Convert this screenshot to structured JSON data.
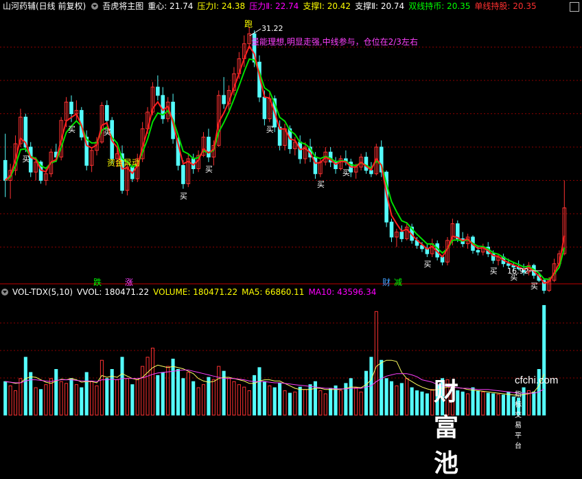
{
  "header": {
    "stock_name": "山河药辅(日线 前复权)",
    "indicator": "吾虎将主图",
    "items": [
      {
        "label": "重心: 21.74",
        "color": "#ffffff"
      },
      {
        "label": "压力Ⅰ: 24.38",
        "color": "#ffff00"
      },
      {
        "label": "压力Ⅱ: 22.74",
        "color": "#ff00ff"
      },
      {
        "label": "支撑Ⅰ: 20.42",
        "color": "#ffff00"
      },
      {
        "label": "支撑Ⅱ: 20.74",
        "color": "#ffffff"
      },
      {
        "label": "双线持币: 20.35",
        "color": "#00ff00"
      },
      {
        "label": "单线持股: 20.35",
        "color": "#ff3030"
      }
    ]
  },
  "volume_header": {
    "name": "VOL-TDX(5,10)",
    "items": [
      {
        "label": "VVOL: 180471.22",
        "color": "#ffffff"
      },
      {
        "label": "VOLUME: 180471.22",
        "color": "#ffff00"
      },
      {
        "label": "MA5: 66860.11",
        "color": "#ffff00"
      },
      {
        "label": "MA10: 43596.34",
        "color": "#ff00ff"
      }
    ]
  },
  "annotations": {
    "high_label": "31.22",
    "low_label": "16.92",
    "run_label": "跑",
    "comment": "量能理想,明显走强,中线参与，仓位在2/3左右",
    "fund_label": "资金异动",
    "buy_label": "买",
    "signal_drop": "跌",
    "signal_rise": "涨",
    "signal_cai": "财",
    "signal_jian": "减"
  },
  "watermark": {
    "cn": "财富池",
    "en": "cfchi.com",
    "sub": "指标交易平台"
  },
  "colors": {
    "up": "#ff3232",
    "down": "#54fcfc",
    "fast_line": "#ff2020",
    "slow_line": "#00e000",
    "ma5": "#ffff60",
    "ma10": "#ff40ff",
    "grid": "#8b0000"
  },
  "chart_data": [
    {
      "type": "candlestick",
      "title": "山河药辅(日线 前复权)",
      "y_range": [
        16,
        32
      ],
      "y_grid_values": [
        18,
        20,
        22,
        24,
        26,
        28,
        30
      ],
      "ohlc": [
        [
          23.2,
          24.8,
          21.0,
          22.0
        ],
        [
          22.0,
          23.0,
          20.9,
          22.6
        ],
        [
          22.6,
          24.7,
          22.3,
          24.2
        ],
        [
          24.2,
          26.3,
          24.0,
          25.8
        ],
        [
          25.8,
          26.0,
          23.7,
          24.0
        ],
        [
          24.0,
          24.3,
          22.2,
          22.5
        ],
        [
          22.5,
          23.4,
          22.0,
          23.1
        ],
        [
          23.1,
          23.2,
          21.8,
          22.0
        ],
        [
          22.0,
          22.8,
          21.7,
          22.4
        ],
        [
          22.4,
          23.9,
          22.2,
          23.7
        ],
        [
          23.7,
          24.2,
          23.1,
          23.4
        ],
        [
          23.4,
          25.8,
          23.2,
          25.6
        ],
        [
          25.6,
          27.0,
          25.2,
          26.7
        ],
        [
          26.7,
          27.1,
          25.5,
          26.0
        ],
        [
          26.0,
          26.8,
          25.6,
          26.2
        ],
        [
          26.2,
          26.4,
          24.4,
          24.6
        ],
        [
          24.6,
          25.0,
          22.6,
          22.9
        ],
        [
          22.9,
          24.0,
          22.5,
          23.8
        ],
        [
          23.8,
          24.6,
          23.5,
          24.3
        ],
        [
          24.3,
          26.7,
          24.2,
          26.5
        ],
        [
          26.5,
          26.8,
          25.3,
          25.6
        ],
        [
          25.6,
          25.8,
          23.0,
          23.3
        ],
        [
          23.3,
          24.0,
          22.8,
          23.6
        ],
        [
          23.6,
          24.1,
          21.2,
          21.4
        ],
        [
          21.4,
          23.1,
          21.1,
          22.8
        ],
        [
          22.8,
          22.9,
          21.9,
          22.1
        ],
        [
          22.1,
          23.6,
          21.9,
          23.3
        ],
        [
          23.3,
          25.5,
          23.1,
          25.1
        ],
        [
          25.1,
          26.4,
          24.8,
          26.1
        ],
        [
          26.1,
          27.9,
          25.9,
          27.6
        ],
        [
          27.6,
          28.3,
          26.8,
          27.1
        ],
        [
          27.1,
          27.6,
          25.4,
          25.7
        ],
        [
          25.7,
          27.0,
          25.5,
          26.7
        ],
        [
          26.7,
          27.2,
          24.2,
          24.5
        ],
        [
          24.5,
          24.8,
          22.6,
          22.9
        ],
        [
          22.9,
          23.2,
          21.5,
          21.8
        ],
        [
          21.8,
          23.6,
          21.6,
          23.3
        ],
        [
          23.3,
          23.6,
          22.4,
          22.7
        ],
        [
          22.7,
          23.8,
          22.5,
          23.5
        ],
        [
          23.5,
          24.9,
          23.4,
          24.6
        ],
        [
          24.6,
          25.1,
          23.1,
          23.4
        ],
        [
          23.4,
          24.4,
          22.9,
          24.1
        ],
        [
          24.1,
          27.4,
          24.0,
          27.1
        ],
        [
          27.1,
          28.2,
          26.3,
          26.6
        ],
        [
          26.6,
          27.7,
          26.2,
          27.4
        ],
        [
          27.4,
          28.8,
          27.1,
          28.4
        ],
        [
          28.4,
          29.7,
          28.1,
          29.3
        ],
        [
          29.3,
          30.7,
          28.8,
          30.2
        ],
        [
          30.2,
          31.22,
          29.9,
          30.8
        ],
        [
          30.8,
          31.0,
          28.8,
          29.1
        ],
        [
          29.1,
          29.5,
          26.7,
          27.0
        ],
        [
          27.0,
          27.4,
          25.3,
          25.7
        ],
        [
          25.7,
          27.3,
          25.5,
          26.9
        ],
        [
          26.9,
          27.1,
          24.9,
          25.2
        ],
        [
          25.2,
          25.6,
          23.8,
          24.1
        ],
        [
          24.1,
          25.4,
          23.8,
          25.1
        ],
        [
          25.1,
          25.3,
          23.6,
          23.9
        ],
        [
          23.9,
          24.6,
          23.5,
          24.3
        ],
        [
          24.3,
          24.7,
          23.0,
          23.3
        ],
        [
          23.3,
          24.3,
          23.0,
          24.0
        ],
        [
          24.0,
          24.5,
          23.1,
          23.4
        ],
        [
          23.4,
          23.7,
          22.1,
          22.4
        ],
        [
          22.4,
          23.3,
          22.2,
          23.1
        ],
        [
          23.1,
          24.0,
          22.9,
          23.7
        ],
        [
          23.7,
          24.0,
          22.8,
          23.1
        ],
        [
          23.1,
          23.4,
          22.4,
          22.7
        ],
        [
          22.7,
          23.5,
          22.6,
          23.3
        ],
        [
          23.3,
          23.8,
          22.9,
          23.1
        ],
        [
          23.1,
          23.3,
          22.2,
          22.5
        ],
        [
          22.5,
          23.0,
          22.1,
          22.8
        ],
        [
          22.8,
          23.6,
          22.6,
          23.4
        ],
        [
          23.4,
          23.7,
          22.4,
          22.6
        ],
        [
          22.6,
          23.1,
          22.2,
          22.4
        ],
        [
          22.4,
          24.2,
          22.3,
          24.0
        ],
        [
          24.0,
          24.4,
          22.2,
          22.5
        ],
        [
          22.5,
          22.6,
          19.2,
          19.5
        ],
        [
          19.5,
          19.7,
          18.3,
          18.6
        ],
        [
          18.6,
          19.1,
          18.0,
          18.9
        ],
        [
          18.9,
          19.3,
          18.3,
          18.5
        ],
        [
          18.5,
          19.5,
          18.4,
          19.2
        ],
        [
          19.2,
          19.4,
          18.2,
          18.4
        ],
        [
          18.4,
          18.6,
          17.9,
          18.1
        ],
        [
          18.1,
          18.3,
          17.7,
          17.9
        ],
        [
          17.9,
          18.2,
          17.4,
          17.6
        ],
        [
          17.6,
          18.5,
          17.4,
          18.2
        ],
        [
          18.2,
          18.4,
          17.2,
          17.4
        ],
        [
          17.4,
          17.5,
          16.9,
          17.1
        ],
        [
          17.1,
          18.6,
          16.9,
          18.4
        ],
        [
          18.4,
          19.7,
          18.1,
          19.4
        ],
        [
          19.4,
          19.6,
          18.3,
          18.5
        ],
        [
          18.5,
          18.9,
          18.0,
          18.2
        ],
        [
          18.2,
          18.8,
          17.9,
          18.6
        ],
        [
          18.6,
          18.7,
          17.6,
          17.8
        ],
        [
          17.8,
          18.1,
          17.5,
          17.7
        ],
        [
          17.7,
          18.2,
          17.5,
          18.0
        ],
        [
          18.0,
          18.3,
          17.4,
          17.6
        ],
        [
          17.6,
          17.8,
          17.0,
          17.2
        ],
        [
          17.2,
          17.6,
          16.9,
          17.4
        ],
        [
          17.4,
          17.6,
          16.8,
          17.0
        ],
        [
          17.0,
          17.3,
          16.7,
          16.9
        ],
        [
          16.9,
          17.1,
          16.6,
          16.8
        ],
        [
          16.8,
          17.2,
          16.6,
          16.7
        ],
        [
          16.7,
          17.0,
          16.3,
          16.5
        ],
        [
          16.5,
          17.1,
          16.3,
          16.9
        ],
        [
          16.9,
          17.0,
          16.1,
          16.3
        ],
        [
          16.3,
          16.4,
          15.9,
          16.0
        ],
        [
          16.0,
          16.1,
          15.2,
          15.4
        ],
        [
          15.4,
          16.2,
          15.3,
          16.0
        ],
        [
          16.0,
          17.3,
          15.9,
          17.0
        ],
        [
          17.0,
          17.8,
          16.8,
          17.6
        ],
        [
          17.6,
          22.0,
          17.5,
          20.35
        ]
      ],
      "volume": [
        55,
        48,
        40,
        60,
        95,
        70,
        45,
        42,
        50,
        60,
        75,
        55,
        52,
        60,
        50,
        45,
        70,
        55,
        48,
        90,
        60,
        75,
        58,
        95,
        60,
        50,
        58,
        80,
        95,
        110,
        65,
        70,
        80,
        92,
        75,
        60,
        70,
        55,
        45,
        50,
        62,
        58,
        80,
        72,
        60,
        55,
        50,
        46,
        40,
        65,
        78,
        55,
        48,
        45,
        52,
        40,
        36,
        38,
        46,
        42,
        50,
        55,
        40,
        35,
        44,
        48,
        40,
        52,
        60,
        45,
        38,
        72,
        95,
        170,
        90,
        60,
        55,
        48,
        52,
        60,
        45,
        40,
        38,
        35,
        42,
        50,
        60,
        58,
        45,
        40,
        38,
        35,
        45,
        40,
        38,
        36,
        35,
        34,
        33,
        38,
        30,
        28,
        45,
        40,
        38,
        75,
        180
      ],
      "ma5": [
        55,
        54,
        52,
        53,
        60,
        63,
        62,
        58,
        54,
        52,
        56,
        59,
        58,
        60,
        58,
        54,
        55,
        55,
        53,
        65,
        62,
        64,
        62,
        68,
        64,
        60,
        58,
        62,
        70,
        78,
        82,
        80,
        78,
        80,
        78,
        76,
        72,
        68,
        60,
        56,
        54,
        55,
        60,
        62,
        62,
        60,
        58,
        56,
        52,
        52,
        56,
        58,
        58,
        56,
        56,
        52,
        48,
        44,
        42,
        42,
        42,
        44,
        44,
        42,
        42,
        42,
        42,
        44,
        46,
        46,
        45,
        50,
        58,
        80,
        86,
        90,
        90,
        88,
        70,
        60,
        55,
        50,
        46,
        43,
        41,
        42,
        44,
        46,
        46,
        45,
        44,
        42,
        41,
        40,
        39,
        38,
        37,
        36,
        35,
        34,
        33,
        32,
        34,
        35,
        38,
        48,
        67
      ],
      "ma10": [
        55,
        54,
        53,
        53,
        56,
        58,
        58,
        57,
        56,
        55,
        57,
        58,
        58,
        58,
        57,
        56,
        56,
        56,
        55,
        58,
        58,
        59,
        58,
        60,
        60,
        60,
        60,
        61,
        64,
        67,
        69,
        70,
        71,
        72,
        73,
        74,
        74,
        72,
        70,
        68,
        66,
        64,
        62,
        60,
        60,
        60,
        59,
        58,
        56,
        55,
        55,
        55,
        54,
        53,
        53,
        52,
        51,
        50,
        49,
        48,
        47,
        46,
        45,
        44,
        44,
        43,
        43,
        43,
        44,
        44,
        44,
        46,
        48,
        55,
        60,
        64,
        66,
        68,
        68,
        68,
        66,
        63,
        58,
        56,
        54,
        50,
        48,
        47,
        46,
        45,
        44,
        44,
        43,
        42,
        42,
        42,
        41,
        40,
        39,
        38,
        37,
        36,
        36,
        36,
        36,
        38,
        43
      ]
    }
  ]
}
